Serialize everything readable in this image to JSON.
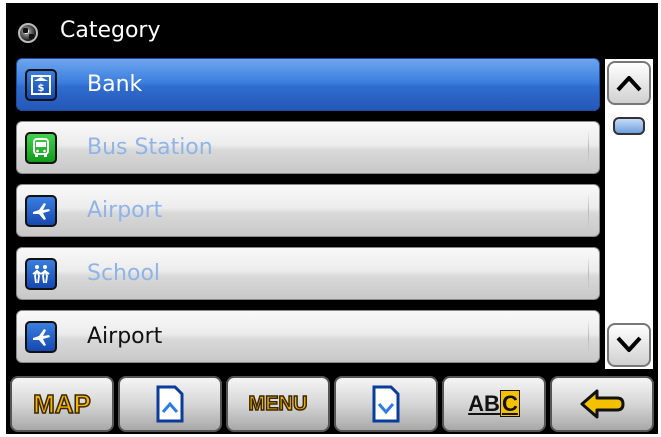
{
  "header": {
    "title": "Category",
    "icon": "category-checker-icon"
  },
  "list": {
    "items": [
      {
        "label": "Bank",
        "icon": "bank-icon",
        "icon_glyph": "$",
        "state": "selected"
      },
      {
        "label": "Bus Station",
        "icon": "bus-icon",
        "icon_glyph": "",
        "state": "dim"
      },
      {
        "label": "Airport",
        "icon": "airplane-icon",
        "icon_glyph": "✈",
        "state": "dim"
      },
      {
        "label": "School",
        "icon": "school-children-icon",
        "icon_glyph": "",
        "state": "dim"
      },
      {
        "label": "Airport",
        "icon": "airplane-icon",
        "icon_glyph": "✈",
        "state": "normal"
      }
    ]
  },
  "scrollbar": {
    "up_icon": "chevron-up-icon",
    "down_icon": "chevron-down-icon"
  },
  "toolbar": {
    "map_label": "MAP",
    "menu_label": "MENU",
    "abc_label_ab": "AB",
    "abc_label_c": "C",
    "page_up_icon": "page-up-icon",
    "page_down_icon": "page-down-icon",
    "back_icon": "back-arrow-icon"
  },
  "colors": {
    "selected": "#2f6ccf",
    "dim_text": "#8fb4e8",
    "toolbar_text": "#f4b400"
  }
}
